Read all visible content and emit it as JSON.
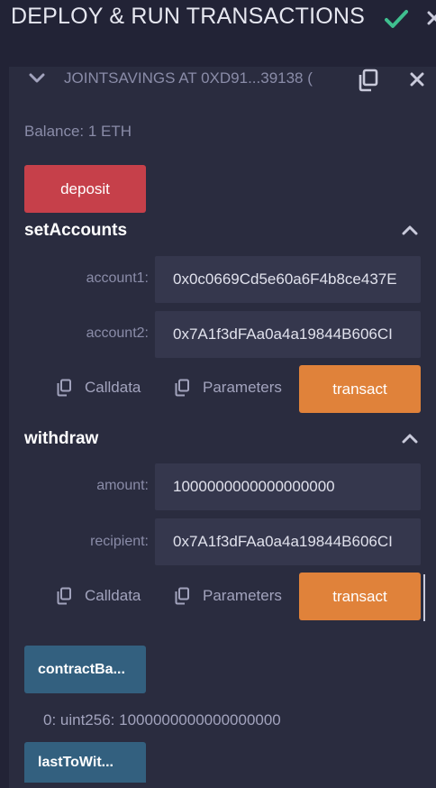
{
  "header": {
    "title": "DEPLOY & RUN TRANSACTIONS"
  },
  "instance": {
    "name": "JOINTSAVINGS AT 0XD91...39138 (",
    "balance": "Balance: 1 ETH"
  },
  "deposit": {
    "label": "deposit"
  },
  "setAccounts": {
    "title": "setAccounts",
    "params": [
      {
        "label": "account1:",
        "value": "0x0c0669Cd5e60a6F4b8ce437E"
      },
      {
        "label": "account2:",
        "value": "0x7A1f3dFAa0a4a19844B606CI"
      }
    ],
    "calldata": "Calldata",
    "parameters": "Parameters",
    "transact": "transact"
  },
  "withdraw": {
    "title": "withdraw",
    "params": [
      {
        "label": "amount:",
        "value": "1000000000000000000"
      },
      {
        "label": "recipient:",
        "value": "0x7A1f3dFAa0a4a19844B606CI"
      }
    ],
    "calldata": "Calldata",
    "parameters": "Parameters",
    "transact": "transact"
  },
  "contractBalance": {
    "label": "contractBa...",
    "result": "0: uint256: 1000000000000000000"
  },
  "lastToWithdraw": {
    "label": "lastToWit..."
  },
  "colors": {
    "background": "#222336",
    "panel": "#2a2c3f",
    "input": "#35374d",
    "red": "#c6404a",
    "orange": "#e0823a",
    "blue": "#33607f",
    "check": "#3fbf8f"
  }
}
